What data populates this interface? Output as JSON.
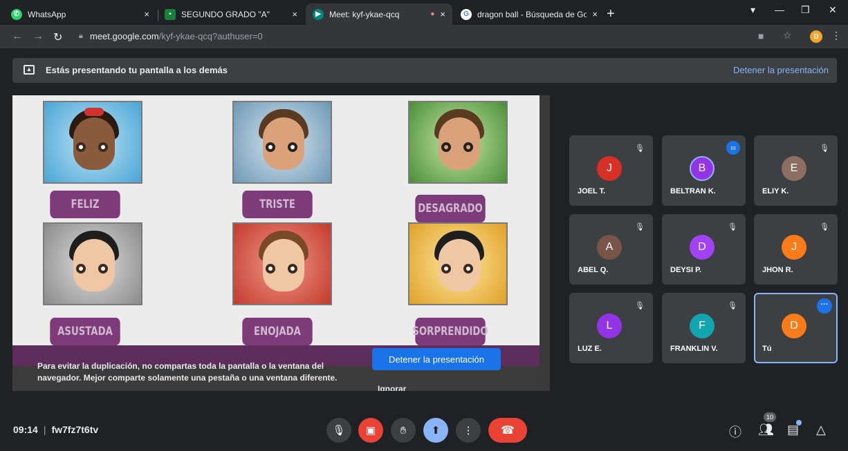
{
  "browser": {
    "tabs": [
      {
        "title": "WhatsApp",
        "color": "#25d366",
        "glyph": "✆"
      },
      {
        "title": "SEGUNDO GRADO \"A\"",
        "color": "#188038",
        "glyph": "▪"
      },
      {
        "title": "Meet: kyf-ykae-qcq",
        "color": "#00897b",
        "glyph": "▶"
      },
      {
        "title": "dragon ball - Búsqueda de Goog",
        "color": "#ffffff",
        "glyph": "G"
      }
    ],
    "close_glyph": "×",
    "new_tab_glyph": "+",
    "url_host": "meet.google.com",
    "url_path": "/kyf-ykae-qcq?authuser=0",
    "profile_initial": "D"
  },
  "banner": {
    "message": "Estás presentando tu pantalla a los demás",
    "stop_link": "Detener la presentación"
  },
  "slide": {
    "emotions": [
      "FELIZ",
      "TRISTE",
      "DESAGRADO",
      "ASUSTADA",
      "ENOJADA",
      "SORPRENDIDO"
    ]
  },
  "dialog": {
    "text": "Para evitar la duplicación, no compartas toda la pantalla o la ventana del navegador. Mejor comparte solamente una pestaña o una ventana diferente.",
    "stop_button": "Detener la presentación",
    "ignore": "Ignorar"
  },
  "participants": [
    {
      "initial": "J",
      "name": "JOEL T.",
      "color": "#d93025",
      "state": "muted"
    },
    {
      "initial": "B",
      "name": "BELTRAN K.",
      "color": "#9334e6",
      "state": "speaking"
    },
    {
      "initial": "E",
      "name": "ELIY K.",
      "color": "#8d6e63",
      "state": "muted"
    },
    {
      "initial": "A",
      "name": "ABEL Q.",
      "color": "#795548",
      "state": "muted"
    },
    {
      "initial": "D",
      "name": "DEYSI P.",
      "color": "#a142f4",
      "state": "muted"
    },
    {
      "initial": "J",
      "name": "JHON R.",
      "color": "#fa7b17",
      "state": "muted"
    },
    {
      "initial": "L",
      "name": "LUZ E.",
      "color": "#9334e6",
      "state": "muted"
    },
    {
      "initial": "F",
      "name": "FRANKLIN V.",
      "color": "#12a4af",
      "state": "muted"
    },
    {
      "initial": "D",
      "name": "Tú",
      "color": "#fa7b17",
      "state": "self"
    }
  ],
  "meeting": {
    "time": "09:14",
    "code": "fw7fz7t6tv",
    "people_count": "10"
  }
}
